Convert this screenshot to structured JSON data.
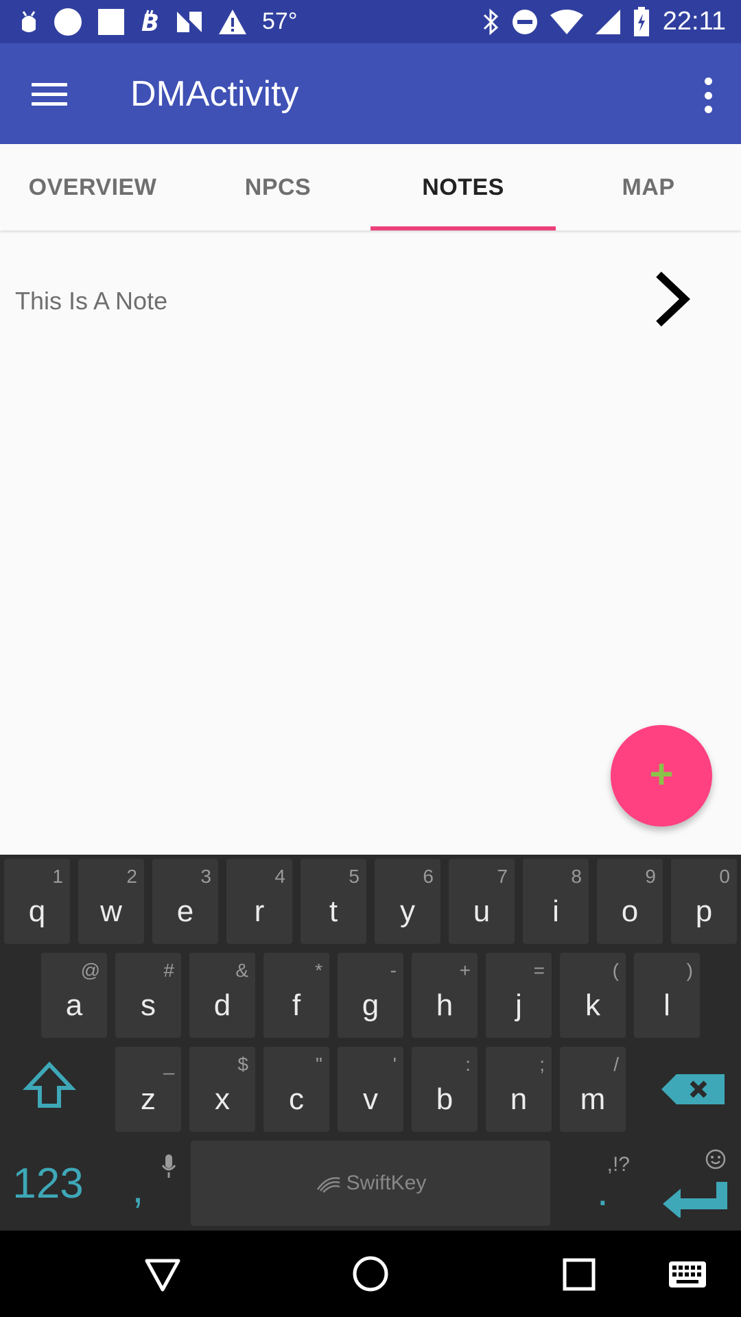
{
  "status_bar": {
    "temperature": "57°",
    "time": "22:11",
    "left_icons": [
      "android-head-icon",
      "circle-icon",
      "square-icon",
      "bitcoin-icon",
      "nfc-icon",
      "warning-icon"
    ],
    "right_icons": [
      "bluetooth-icon",
      "do-not-disturb-icon",
      "wifi-icon",
      "cell-signal-icon",
      "battery-charging-icon"
    ]
  },
  "app_bar": {
    "title": "DMActivity",
    "menu_icon": "hamburger-menu-icon",
    "overflow_icon": "more-vert-icon"
  },
  "tabs": [
    {
      "label": "OVERVIEW",
      "active": false
    },
    {
      "label": "NPCS",
      "active": false
    },
    {
      "label": "NOTES",
      "active": true
    },
    {
      "label": "MAP",
      "active": false
    }
  ],
  "notes": {
    "items": [
      {
        "title": "This Is A Note",
        "action_icon": "chevron-right-icon"
      }
    ]
  },
  "fab": {
    "label": "+",
    "icon": "add-icon"
  },
  "keyboard": {
    "brand": "SwiftKey",
    "row1": [
      {
        "key": "q",
        "hint": "1"
      },
      {
        "key": "w",
        "hint": "2"
      },
      {
        "key": "e",
        "hint": "3"
      },
      {
        "key": "r",
        "hint": "4"
      },
      {
        "key": "t",
        "hint": "5"
      },
      {
        "key": "y",
        "hint": "6"
      },
      {
        "key": "u",
        "hint": "7"
      },
      {
        "key": "i",
        "hint": "8"
      },
      {
        "key": "o",
        "hint": "9"
      },
      {
        "key": "p",
        "hint": "0"
      }
    ],
    "row2": [
      {
        "key": "a",
        "hint": "@"
      },
      {
        "key": "s",
        "hint": "#"
      },
      {
        "key": "d",
        "hint": "&"
      },
      {
        "key": "f",
        "hint": "*"
      },
      {
        "key": "g",
        "hint": "-"
      },
      {
        "key": "h",
        "hint": "+"
      },
      {
        "key": "j",
        "hint": "="
      },
      {
        "key": "k",
        "hint": "("
      },
      {
        "key": "l",
        "hint": ")"
      }
    ],
    "row3": [
      {
        "key": "z",
        "hint": "_"
      },
      {
        "key": "x",
        "hint": "$"
      },
      {
        "key": "c",
        "hint": "\""
      },
      {
        "key": "v",
        "hint": "'"
      },
      {
        "key": "b",
        "hint": ":"
      },
      {
        "key": "n",
        "hint": ";"
      },
      {
        "key": "m",
        "hint": "/"
      }
    ],
    "row4": {
      "num_label": "123",
      "comma": ",",
      "period": ".",
      "period_hint": ",!?"
    },
    "accent_color": "#3ea8b8"
  },
  "nav_bar": {
    "icons": [
      "back-triangle-icon",
      "home-circle-icon",
      "recents-square-icon",
      "keyboard-icon"
    ]
  },
  "colors": {
    "status_bar": "#303f9f",
    "app_bar": "#3f51b5",
    "tab_indicator": "#ec407a",
    "fab": "#ff4081",
    "fab_plus": "#8bc34a"
  }
}
